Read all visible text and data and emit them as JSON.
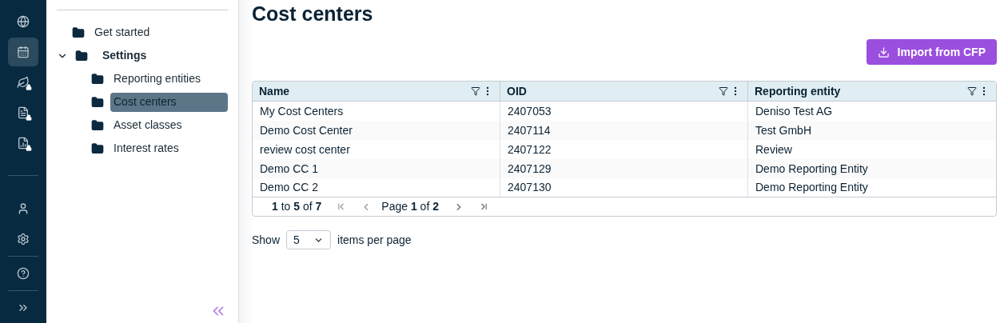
{
  "rail": [
    {
      "selected": false
    },
    {
      "selected": true
    },
    {
      "selected": false
    },
    {
      "selected": false
    },
    {
      "selected": false
    },
    {
      "selected": false
    },
    {
      "selected": false
    },
    {
      "selected": false
    },
    {
      "selected": false
    }
  ],
  "tree": [
    {
      "label": "Get started",
      "selected": false
    },
    {
      "label": "Settings",
      "selected": false,
      "expanded": true,
      "children": [
        {
          "label": "Reporting entities",
          "selected": false
        },
        {
          "label": "Cost centers",
          "selected": true
        },
        {
          "label": "Asset classes",
          "selected": false
        },
        {
          "label": "Interest rates",
          "selected": false
        }
      ]
    }
  ],
  "page_title": "Cost centers",
  "import_button": "Import from CFP",
  "table": {
    "columns": [
      "Name",
      "OID",
      "Reporting entity"
    ],
    "rows": [
      [
        "My Cost Centers",
        "2407053",
        "Deniso Test AG"
      ],
      [
        "Demo Cost Center",
        "2407114",
        "Test GmbH"
      ],
      [
        "review cost center",
        "2407122",
        "Review"
      ],
      [
        "Demo CC 1",
        "2407129",
        "Demo Reporting Entity"
      ],
      [
        "Demo CC 2",
        "2407130",
        "Demo Reporting Entity"
      ]
    ],
    "range": "**1** to **5** of **7**",
    "page": "Page **1** of **2**"
  },
  "page_size": {
    "label": "Show",
    "value": "5",
    "suffix": "items per page"
  }
}
